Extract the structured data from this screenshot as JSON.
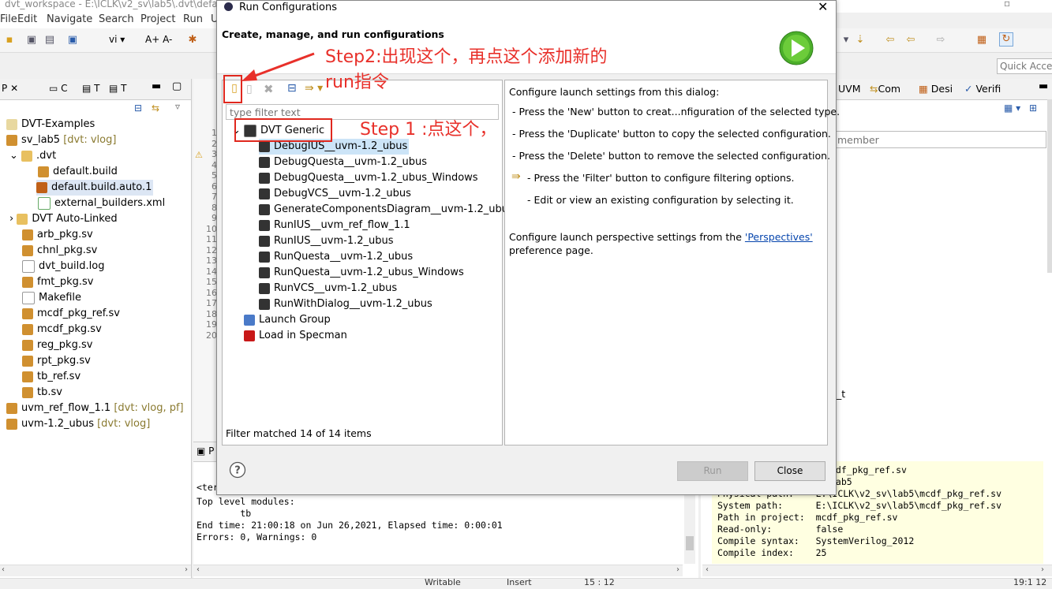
{
  "window": {
    "title": "dvt_workspace - E:\\ICLK\\v2_sv\\lab5\\.dvt\\defau"
  },
  "menu": [
    "File",
    "Edit",
    "Navigate",
    "Search",
    "Project",
    "Run",
    "U"
  ],
  "quick_access": {
    "placeholder": "Quick Access"
  },
  "left_view": {
    "tabs": [
      "P",
      "C",
      "T",
      "T"
    ],
    "tree": [
      {
        "label": "DVT-Examples",
        "decoration": ""
      },
      {
        "label": "sv_lab5",
        "decoration": "[dvt: vlog]"
      },
      {
        "label": ".dvt",
        "decoration": ""
      },
      {
        "label": "default.build",
        "decoration": ""
      },
      {
        "label": "default.build.auto.1",
        "decoration": ""
      },
      {
        "label": "external_builders.xml",
        "decoration": ""
      },
      {
        "label": "DVT Auto-Linked",
        "decoration": ""
      },
      {
        "label": "arb_pkg.sv",
        "decoration": ""
      },
      {
        "label": "chnl_pkg.sv",
        "decoration": ""
      },
      {
        "label": "dvt_build.log",
        "decoration": ""
      },
      {
        "label": "fmt_pkg.sv",
        "decoration": ""
      },
      {
        "label": "Makefile",
        "decoration": ""
      },
      {
        "label": "mcdf_pkg_ref.sv",
        "decoration": ""
      },
      {
        "label": "mcdf_pkg.sv",
        "decoration": ""
      },
      {
        "label": "reg_pkg.sv",
        "decoration": ""
      },
      {
        "label": "rpt_pkg.sv",
        "decoration": ""
      },
      {
        "label": "tb_ref.sv",
        "decoration": ""
      },
      {
        "label": "tb.sv",
        "decoration": ""
      },
      {
        "label": "uvm_ref_flow_1.1",
        "decoration": "[dvt: vlog, pf]"
      },
      {
        "label": "uvm-1.2_ubus",
        "decoration": "[dvt: vlog]"
      }
    ]
  },
  "editor": {
    "line_numbers": [
      "1",
      "2",
      "3",
      "4",
      "5",
      "6",
      "7",
      "8",
      "9",
      "10",
      "11",
      "12",
      "13",
      "14",
      "15",
      "16",
      "17",
      "18",
      "19",
      "20"
    ],
    "right_tabs": [
      "UVM",
      "Com",
      "Desi",
      "Verifi"
    ],
    "filter_placeholder": "member",
    "fragment": "_t"
  },
  "console": {
    "tab": "P",
    "head": "<ter",
    "lines": [
      "Top level modules:",
      "        tb",
      "End time: 21:00:18 on Jun 26,2021, Elapsed time: 0:00:01",
      "Errors: 0, Warnings: 0"
    ]
  },
  "properties": {
    "lines": [
      "fdf_pkg_ref.sv",
      "lab5",
      "Physical path:    E:\\ICLK\\v2_sv\\lab5\\mcdf_pkg_ref.sv",
      "System path:      E:\\ICLK\\v2_sv\\lab5\\mcdf_pkg_ref.sv",
      "Path in project:  mcdf_pkg_ref.sv",
      "Read-only:        false",
      "Compile syntax:   SystemVerilog_2012",
      "Compile index:    25"
    ]
  },
  "status_bar": {
    "writable": "Writable",
    "insert": "Insert",
    "position": "15 : 12",
    "time": "19:1 12"
  },
  "dialog": {
    "title": "Run Configurations",
    "header": "Create, manage, and run configurations",
    "filter_placeholder": "type filter text",
    "tree": {
      "category": "DVT Generic",
      "configs": [
        "DebugIUS__uvm-1.2_ubus",
        "DebugQuesta__uvm-1.2_ubus",
        "DebugQuesta__uvm-1.2_ubus_Windows",
        "DebugVCS__uvm-1.2_ubus",
        "GenerateComponentsDiagram__uvm-1.2_ubus",
        "RunIUS__uvm_ref_flow_1.1",
        "RunIUS__uvm-1.2_ubus",
        "RunQuesta__uvm-1.2_ubus",
        "RunQuesta__uvm-1.2_ubus_Windows",
        "RunVCS__uvm-1.2_ubus",
        "RunWithDialog__uvm-1.2_ubus"
      ],
      "others": [
        "Launch Group",
        "Load in Specman"
      ]
    },
    "filter_status": "Filter matched 14 of 14 items",
    "help": {
      "intro": "Configure launch settings from this dialog:",
      "new": "- Press the 'New' button to creat...nfiguration of the selected type.",
      "duplicate": "- Press the 'Duplicate' button to copy the selected configuration.",
      "delete": "- Press the 'Delete' button to remove the selected configuration.",
      "filter": "- Press the 'Filter' button to configure filtering options.",
      "edit": "- Edit or view an existing configuration by selecting it.",
      "persp_before": "Configure launch perspective settings from the ",
      "persp_link": "'Perspectives'",
      "persp_after": "preference page."
    },
    "buttons": {
      "run": "Run",
      "close": "Close"
    }
  },
  "annotations": {
    "step2_line1": "Step2:出现这个，再点这个添加新的",
    "step2_line2": "run指令",
    "step1": "Step 1 :点这个，"
  }
}
